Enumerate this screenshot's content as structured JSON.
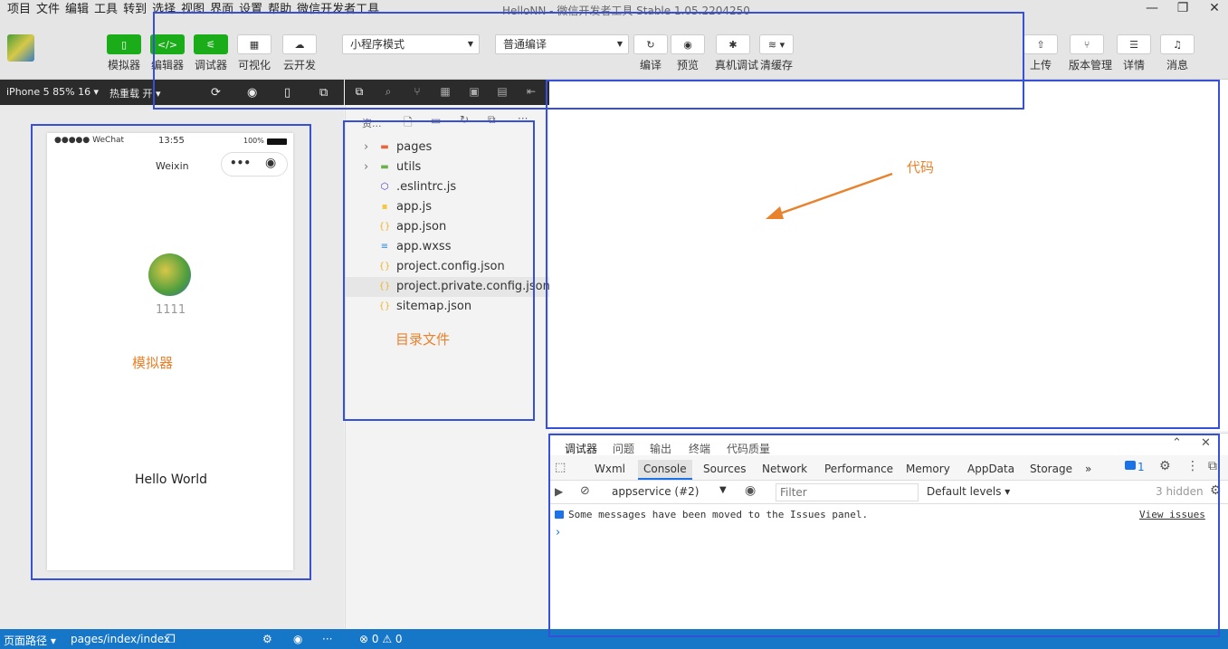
{
  "menu": [
    "项目",
    "文件",
    "编辑",
    "工具",
    "转到",
    "选择",
    "视图",
    "界面",
    "设置",
    "帮助",
    "微信开发者工具"
  ],
  "window_title": "HelloNN - 微信开发者工具 Stable 1.05.2204250",
  "toolbar": {
    "left_buttons": [
      {
        "label": "模拟器",
        "icon": "phone-icon"
      },
      {
        "label": "编辑器",
        "icon": "code-icon"
      },
      {
        "label": "调试器",
        "icon": "debug-icon"
      },
      {
        "label": "可视化",
        "icon": "layout-icon"
      },
      {
        "label": "云开发",
        "icon": "cloud-icon"
      }
    ],
    "mode_select": "小程序模式",
    "compile_select": "普通编译",
    "mid_buttons": [
      {
        "label": "编译",
        "icon": "refresh-icon"
      },
      {
        "label": "预览",
        "icon": "eye-icon"
      },
      {
        "label": "真机调试",
        "icon": "bug-icon"
      },
      {
        "label": "清缓存",
        "icon": "layers-icon"
      }
    ],
    "right_buttons": [
      {
        "label": "上传",
        "icon": "upload-icon"
      },
      {
        "label": "版本管理",
        "icon": "branch-icon"
      },
      {
        "label": "详情",
        "icon": "menu-icon"
      },
      {
        "label": "消息",
        "icon": "bell-icon"
      }
    ]
  },
  "simbar": {
    "device": "iPhone 5 85% 16 ▾",
    "hotreload": "热重载 开 ▾"
  },
  "filebar": {
    "header": "资..."
  },
  "phone": {
    "carrier": "●●●●● WeChat",
    "time": "13:55",
    "battery": "100%",
    "nav_title": "Weixin",
    "nickname": "1111",
    "hello": "Hello World"
  },
  "files": [
    {
      "name": "pages",
      "type": "folder",
      "color": "#e8663d",
      "arrow": "›"
    },
    {
      "name": "utils",
      "type": "folder",
      "color": "#6fb04e",
      "arrow": "›"
    },
    {
      "name": ".eslintrc.js",
      "type": "eslint",
      "color": "#4b32c3",
      "arrow": ""
    },
    {
      "name": "app.js",
      "type": "js",
      "color": "#f5c842",
      "arrow": ""
    },
    {
      "name": "app.json",
      "type": "json",
      "color": "#f0b429",
      "arrow": ""
    },
    {
      "name": "app.wxss",
      "type": "css",
      "color": "#2b8ad6",
      "arrow": ""
    },
    {
      "name": "project.config.json",
      "type": "json",
      "color": "#f0b429",
      "arrow": ""
    },
    {
      "name": "project.private.config.json",
      "type": "json",
      "color": "#f0b429",
      "arrow": ""
    },
    {
      "name": "sitemap.json",
      "type": "json",
      "color": "#f0b429",
      "arrow": ""
    }
  ],
  "devtools": {
    "top_tabs": [
      "调试器",
      "问题",
      "输出",
      "终端",
      "代码质量"
    ],
    "tabs": [
      "Wxml",
      "Console",
      "Sources",
      "Network",
      "Performance",
      "Memory",
      "AppData",
      "Storage",
      "»"
    ],
    "active_tab": "Console",
    "issues_count": "1",
    "context": "appservice (#2)",
    "filter_placeholder": "Filter",
    "levels": "Default levels ▾",
    "hidden": "3 hidden",
    "message": "Some messages have been moved to the Issues panel.",
    "view_issues": "View issues",
    "prompt": "›"
  },
  "statusbar": {
    "path_label": "页面路径 ▾",
    "path": "pages/index/index",
    "errors": "⊗ 0 ⚠ 0"
  },
  "annotations": {
    "simulator": "模拟器",
    "directory": "目录文件",
    "code": "代码"
  },
  "colors": {
    "accent_green": "#1aad19",
    "status_blue": "#1677c9",
    "annotation_orange": "#e8822c",
    "highlight_blue": "#3650d8"
  }
}
